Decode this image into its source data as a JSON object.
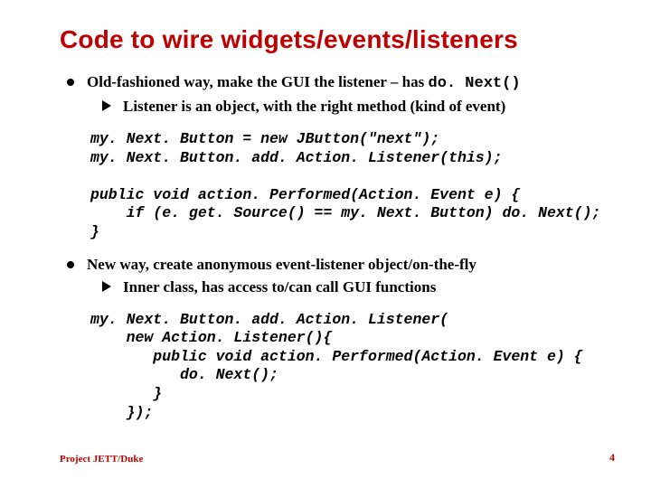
{
  "title": "Code to wire widgets/events/listeners",
  "bullet1": {
    "prefix": "Old-fashioned way, make the GUI the listener – has ",
    "code": "do. Next()",
    "sub": "Listener is an object, with the right method (kind of event)"
  },
  "code1": "my. Next. Button = new JButton(\"next\");\nmy. Next. Button. add. Action. Listener(this);\n\npublic void action. Performed(Action. Event e) {\n    if (e. get. Source() == my. Next. Button) do. Next();\n}",
  "bullet2": {
    "text": "New way, create anonymous event-listener object/on-the-fly",
    "sub": "Inner class, has access to/can call GUI functions"
  },
  "code2": "my. Next. Button. add. Action. Listener(\n    new Action. Listener(){\n       public void action. Performed(Action. Event e) {\n          do. Next();\n       }\n    });",
  "footer": {
    "left": "Project JETT/Duke",
    "right": "4"
  }
}
